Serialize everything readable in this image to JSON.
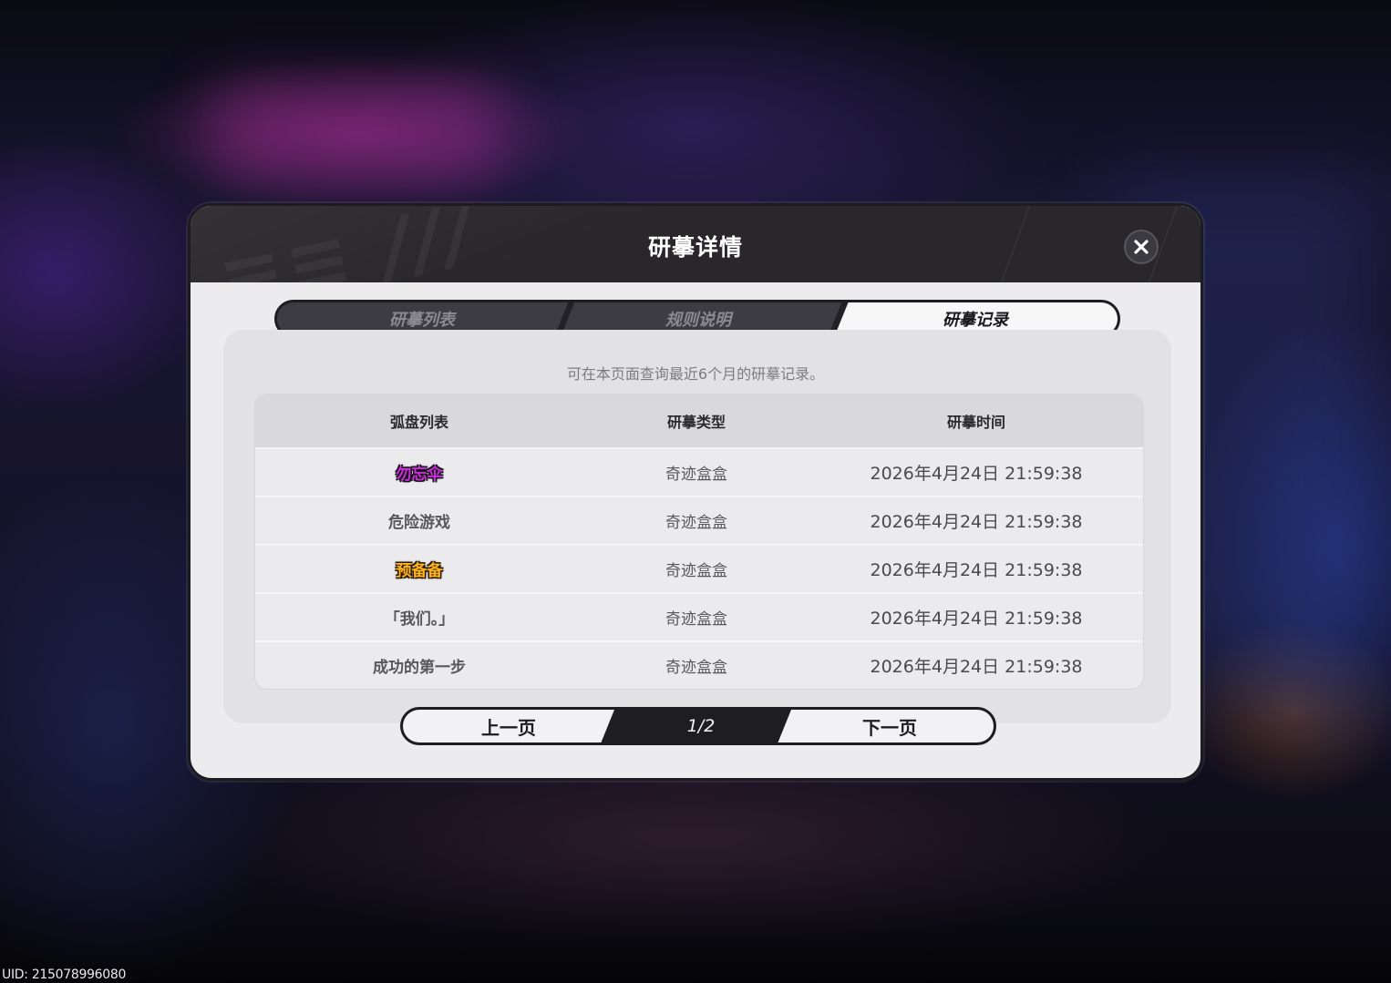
{
  "dialog": {
    "title": "研摹详情"
  },
  "tabs": [
    {
      "label": "研摹列表",
      "active": false
    },
    {
      "label": "规则说明",
      "active": false
    },
    {
      "label": "研摹记录",
      "active": true
    }
  ],
  "hint": "可在本页面查询最近6个月的研摹记录。",
  "table": {
    "headers": [
      "弧盘列表",
      "研摹类型",
      "研摹时间"
    ],
    "rows": [
      {
        "item": "勿忘伞",
        "rarity": "purple",
        "type": "奇迹盒盒",
        "time": "2026年4月24日 21:59:38"
      },
      {
        "item": "危险游戏",
        "rarity": "normal",
        "type": "奇迹盒盒",
        "time": "2026年4月24日 21:59:38"
      },
      {
        "item": "预备备",
        "rarity": "gold",
        "type": "奇迹盒盒",
        "time": "2026年4月24日 21:59:38"
      },
      {
        "item": "「我们。」",
        "rarity": "normal",
        "type": "奇迹盒盒",
        "time": "2026年4月24日 21:59:38"
      },
      {
        "item": "成功的第一步",
        "rarity": "normal",
        "type": "奇迹盒盒",
        "time": "2026年4月24日 21:59:38"
      }
    ]
  },
  "pager": {
    "prev_label": "上一页",
    "page": "1/2",
    "next_label": "下一页"
  },
  "uid": "UID: 215078996080",
  "colors": {
    "rarity_purple": "#c92fd8",
    "rarity_gold": "#ffb21c"
  },
  "icons": {
    "close": "close-icon"
  }
}
